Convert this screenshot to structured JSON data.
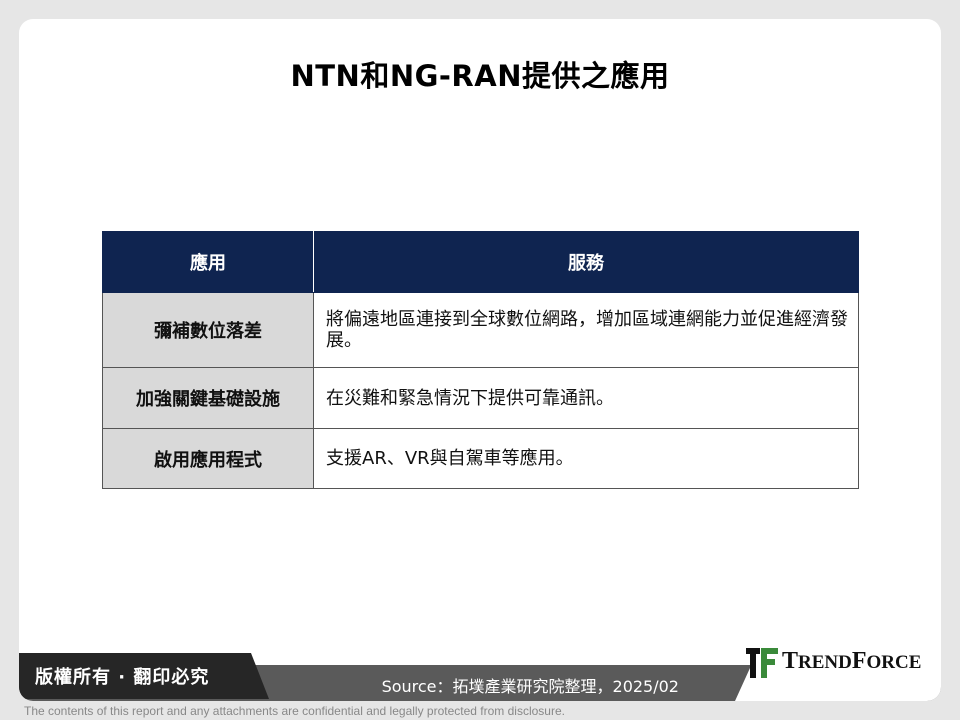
{
  "title": "NTN和NG-RAN提供之應用",
  "table": {
    "headers": [
      "應用",
      "服務"
    ],
    "rows": [
      {
        "application": "彌補數位落差",
        "service": "將偏遠地區連接到全球數位網路，增加區域連網能力並促進經濟發展。"
      },
      {
        "application": "加強關鍵基礎設施",
        "service": "在災難和緊急情況下提供可靠通訊。"
      },
      {
        "application": "啟用應用程式",
        "service": "支援AR、VR與自駕車等應用。"
      }
    ]
  },
  "footer": {
    "copyright": "版權所有 · 翻印必究",
    "source": "Source：拓墣產業研究院整理，2025/02",
    "logo_first": "T",
    "logo_rest1": "REND",
    "logo_mid": "F",
    "logo_rest2": "ORCE",
    "disclaimer": "The contents of this report and any attachments are confidential and legally protected from disclosure."
  },
  "colors": {
    "header_bg": "#0f2450",
    "label_cell_bg": "#d9d9d9",
    "logo_green": "#3a8a3a"
  },
  "icons": {
    "logo": "trendforce-logo-icon"
  }
}
